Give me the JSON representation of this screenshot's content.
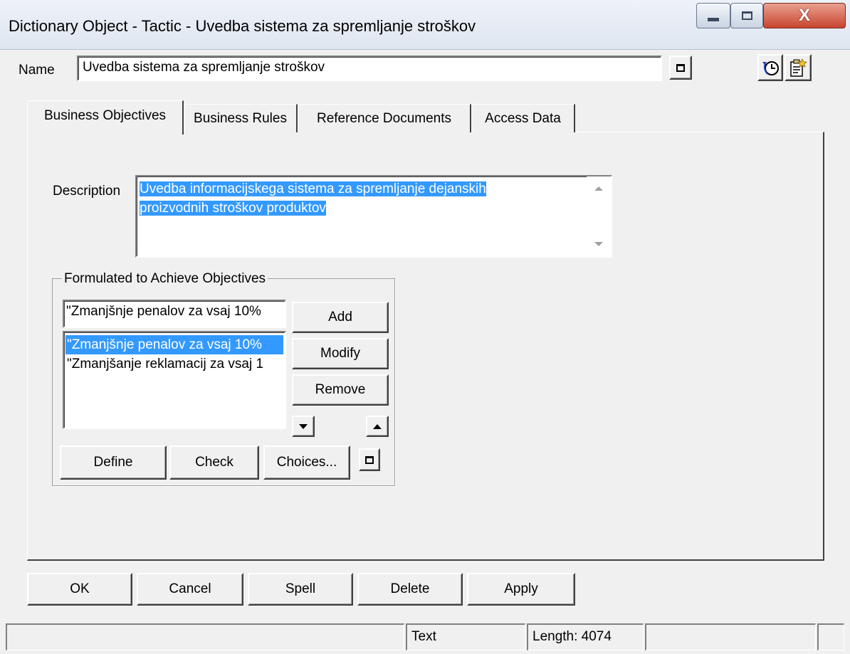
{
  "window": {
    "title": "Dictionary Object - Tactic - Uvedba sistema za spremljanje stroškov",
    "close_glyph": "X"
  },
  "name_field": {
    "label": "Name",
    "value": "Uvedba sistema za spremljanje stroškov"
  },
  "tabs": [
    {
      "label": "Business Objectives",
      "active": true
    },
    {
      "label": "Business Rules",
      "active": false
    },
    {
      "label": "Reference Documents",
      "active": false
    },
    {
      "label": "Access Data",
      "active": false
    }
  ],
  "description": {
    "label": "Description",
    "lines": [
      "Uvedba informacijskega sistema za spremljanje dejanskih",
      "proizvodnih stroškov produktov"
    ]
  },
  "objectives_group": {
    "title": "Formulated to Achieve Objectives",
    "input_value": "\"Zmanjšnje penalov za vsaj 10%",
    "list_items": [
      {
        "text": "\"Zmanjšnje penalov za vsaj 10%",
        "selected": true
      },
      {
        "text": "\"Zmanjšanje reklamacij za vsaj 1",
        "selected": false
      }
    ],
    "buttons": {
      "add": "Add",
      "modify": "Modify",
      "remove": "Remove",
      "define": "Define",
      "check": "Check",
      "choices": "Choices..."
    }
  },
  "footer_buttons": {
    "ok": "OK",
    "cancel": "Cancel",
    "spell": "Spell",
    "delete": "Delete",
    "apply": "Apply"
  },
  "status_bar": {
    "mode": "Text",
    "length": "Length: 4074"
  },
  "colors": {
    "selection": "#3399ff",
    "face": "#f0f0f0"
  }
}
